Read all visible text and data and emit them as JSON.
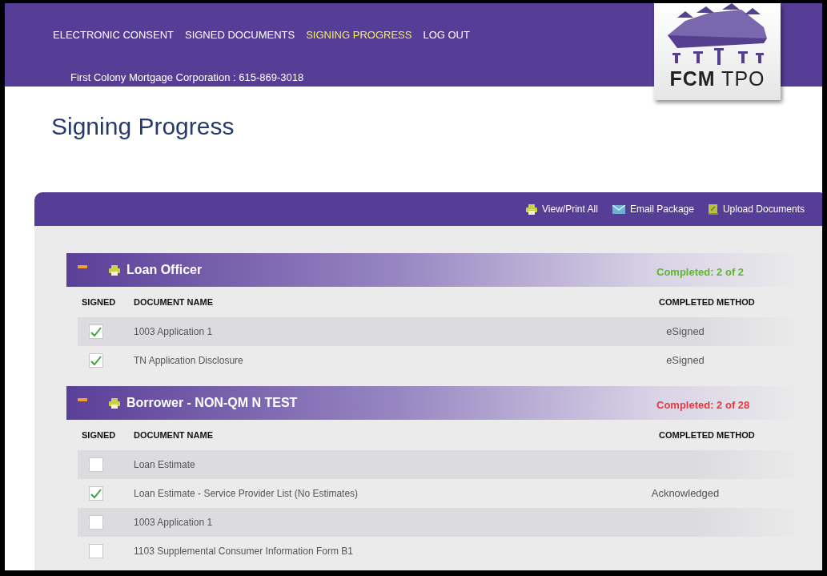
{
  "nav": [
    {
      "label": "ELECTRONIC CONSENT",
      "selected": false
    },
    {
      "label": "SIGNED DOCUMENTS",
      "selected": false
    },
    {
      "label": "SIGNING PROGRESS",
      "selected": true
    },
    {
      "label": "LOG OUT",
      "selected": false
    }
  ],
  "company_line": "First Colony Mortgage Corporation : 615-869-3018",
  "logo": {
    "bold": "FCM",
    "light": "TPO"
  },
  "page_title": "Signing Progress",
  "actions": [
    {
      "label": "View/Print All",
      "kind": "print"
    },
    {
      "label": "Email Package",
      "kind": "email"
    },
    {
      "label": "Upload Documents",
      "kind": "upload"
    }
  ],
  "sections": [
    {
      "title": "Loan Officer",
      "completed": "Completed: 2 of 2",
      "color": "#5cb82a",
      "expanded": true,
      "columns": [
        "SIGNED",
        "DOCUMENT NAME",
        "COMPLETED METHOD"
      ],
      "documents": [
        {
          "name": "1003 Application 1",
          "signed": true,
          "method": "eSigned"
        },
        {
          "name": "TN Application Disclosure",
          "signed": true,
          "method": "eSigned"
        }
      ]
    },
    {
      "title": "Borrower - NON-QM N TEST",
      "completed": "Completed: 2 of 28",
      "color": "#e8383d",
      "expanded": true,
      "columns": [
        "SIGNED",
        "DOCUMENT NAME",
        "COMPLETED METHOD"
      ],
      "documents": [
        {
          "name": "Loan Estimate",
          "signed": false
        },
        {
          "name": "Loan Estimate - Service Provider List (No Estimates)",
          "signed": true,
          "method": "Acknowledged"
        },
        {
          "name": "1003 Application 1",
          "signed": false
        },
        {
          "name": "1103 Supplemental Consumer Information Form B1",
          "signed": false
        }
      ]
    }
  ]
}
